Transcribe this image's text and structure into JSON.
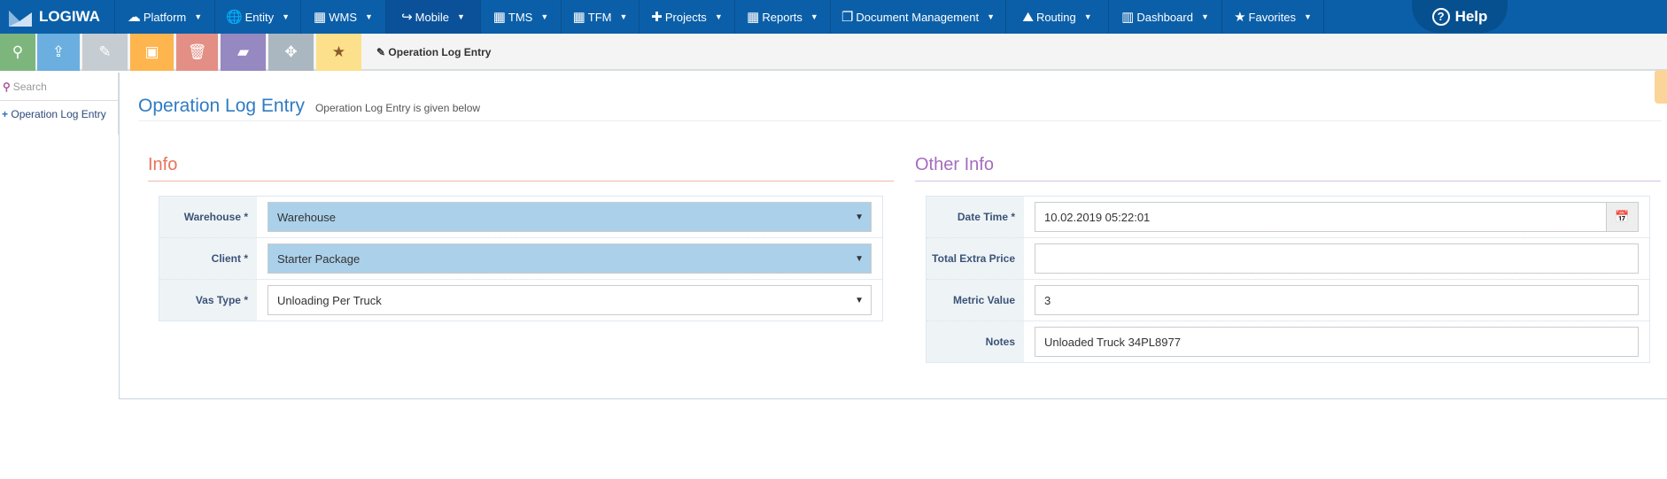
{
  "nav": {
    "brand": "LOGIWA",
    "items": [
      {
        "label": "Platform",
        "icon": "cloud-icon",
        "glyph": "☁"
      },
      {
        "label": "Entity",
        "icon": "globe-icon",
        "glyph": "🌐"
      },
      {
        "label": "WMS",
        "icon": "building-icon",
        "glyph": "▦"
      },
      {
        "label": "Mobile",
        "icon": "share-icon",
        "glyph": "↪"
      },
      {
        "label": "TMS",
        "icon": "building-icon",
        "glyph": "▦"
      },
      {
        "label": "TFM",
        "icon": "building-icon",
        "glyph": "▦"
      },
      {
        "label": "Projects",
        "icon": "plus-icon",
        "glyph": "✚"
      },
      {
        "label": "Reports",
        "icon": "building-icon",
        "glyph": "▦"
      },
      {
        "label": "Document Management",
        "icon": "copy-icon",
        "glyph": "❐"
      },
      {
        "label": "Routing",
        "icon": "road-icon",
        "glyph": "⛰"
      },
      {
        "label": "Dashboard",
        "icon": "bar-chart-icon",
        "glyph": "▥"
      },
      {
        "label": "Favorites",
        "icon": "star-icon",
        "glyph": "★"
      }
    ],
    "help": "Help"
  },
  "toolbar": {
    "breadcrumb": "Operation Log Entry",
    "colors": [
      "#7db67d",
      "#6aafdf",
      "#c5ccd2",
      "#feb54d",
      "#e38f85",
      "#9688c1",
      "#abb7c0",
      "#fde08b"
    ]
  },
  "sidebar": {
    "search_placeholder": "Search",
    "item": "Operation Log Entry"
  },
  "page": {
    "title": "Operation Log Entry",
    "subtitle": "Operation Log Entry is given below"
  },
  "info": {
    "title": "Info",
    "fields": [
      {
        "label": "Warehouse *",
        "value": "Warehouse"
      },
      {
        "label": "Client *",
        "value": "Starter Package"
      },
      {
        "label": "Vas Type *",
        "value": "Unloading Per Truck"
      }
    ]
  },
  "other": {
    "title": "Other Info",
    "fields": [
      {
        "label": "Date Time *",
        "value": "10.02.2019 05:22:01"
      },
      {
        "label": "Total Extra Price",
        "value": ""
      },
      {
        "label": "Metric Value",
        "value": "3"
      },
      {
        "label": "Notes",
        "value": "Unloaded Truck 34PL8977"
      }
    ]
  }
}
